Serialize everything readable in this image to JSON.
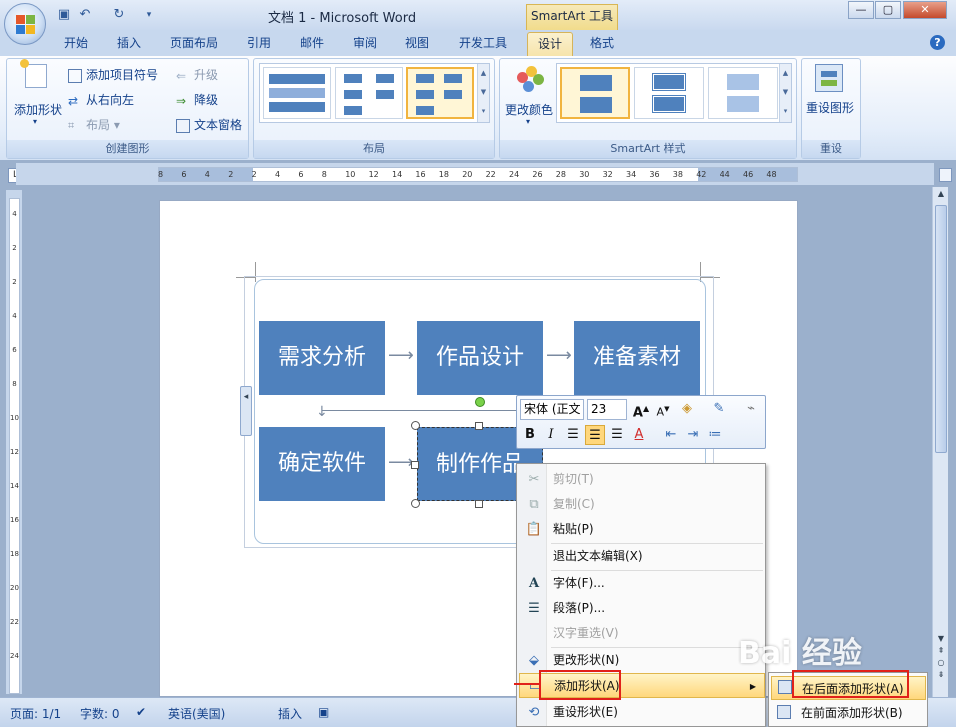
{
  "window": {
    "title": "文档 1 - Microsoft Word",
    "context_title": "SmartArt 工具"
  },
  "tabs": [
    "开始",
    "插入",
    "页面布局",
    "引用",
    "邮件",
    "审阅",
    "视图",
    "开发工具",
    "设计",
    "格式"
  ],
  "ribbon": {
    "create_graphic": {
      "label": "创建图形",
      "add_shape": "添加形状",
      "add_bullet": "添加项目符号",
      "right_to_left": "从右向左",
      "layout": "布局",
      "promote": "升级",
      "demote": "降级",
      "text_pane": "文本窗格"
    },
    "layouts": {
      "label": "布局"
    },
    "smartart_styles": {
      "label": "SmartArt 样式",
      "change_colors": "更改颜色"
    },
    "reset": {
      "label": "重设",
      "reset_graphic": "重设图形"
    }
  },
  "ruler": {
    "h_numbers": [
      "8",
      "6",
      "4",
      "2",
      "2",
      "4",
      "6",
      "8",
      "10",
      "12",
      "14",
      "16",
      "18",
      "20",
      "22",
      "24",
      "26",
      "28",
      "30",
      "32",
      "34",
      "36",
      "38",
      "42",
      "44",
      "46",
      "48"
    ],
    "v_numbers": [
      "4",
      "2",
      "2",
      "4",
      "6",
      "8",
      "10",
      "12",
      "14",
      "16",
      "18",
      "20",
      "22",
      "24"
    ]
  },
  "smartart": {
    "boxes": [
      "需求分析",
      "作品设计",
      "准备素材",
      "确定软件",
      "制作作品"
    ]
  },
  "mini_toolbar": {
    "font": "宋体 (正文",
    "size": "23"
  },
  "context_menu": {
    "items": [
      {
        "label": "剪切(T)",
        "enabled": false
      },
      {
        "label": "复制(C)",
        "enabled": false
      },
      {
        "label": "粘贴(P)",
        "enabled": true
      },
      {
        "label": "退出文本编辑(X)",
        "enabled": true
      },
      {
        "label": "字体(F)...",
        "enabled": true
      },
      {
        "label": "段落(P)...",
        "enabled": true
      },
      {
        "label": "汉字重选(V)",
        "enabled": false
      },
      {
        "label": "更改形状(N)",
        "enabled": true
      },
      {
        "label": "添加形状(A)",
        "enabled": true
      },
      {
        "label": "重设形状(E)",
        "enabled": true
      }
    ]
  },
  "submenu": {
    "items": [
      "在后面添加形状(A)",
      "在前面添加形状(B)"
    ]
  },
  "statusbar": {
    "page": "页面: 1/1",
    "words": "字数: 0",
    "language": "英语(美国)",
    "mode": "插入"
  },
  "watermark": "Bai  经验",
  "colors": {
    "smartart_box": "#4f81bd",
    "highlight": "#ffd77c",
    "callout_red": "#e1211a"
  }
}
